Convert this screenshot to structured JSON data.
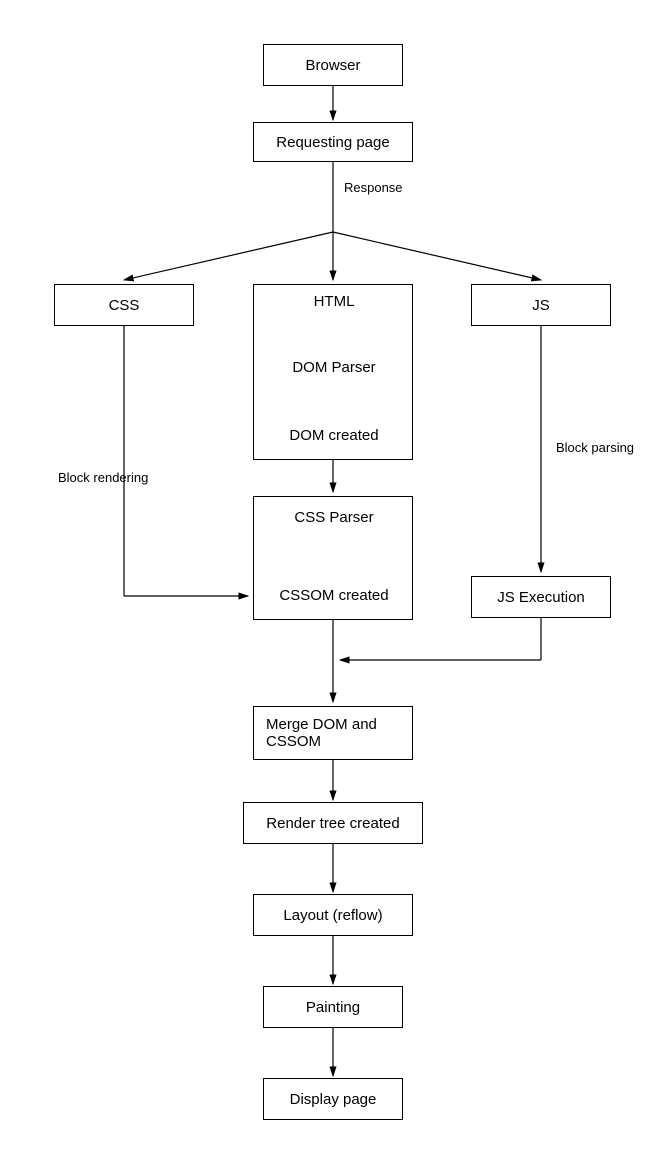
{
  "nodes": {
    "browser": "Browser",
    "requesting_page": "Requesting page",
    "css": "CSS",
    "html": "HTML",
    "dom_parser": "DOM Parser",
    "dom_created": "DOM created",
    "js": "JS",
    "css_parser": "CSS Parser",
    "cssom_created": "CSSOM created",
    "js_execution": "JS Execution",
    "merge": "Merge DOM and CSSOM",
    "render_tree": "Render tree created",
    "layout": "Layout (reflow)",
    "painting": "Painting",
    "display_page": "Display page"
  },
  "edges": {
    "response": "Response",
    "block_rendering": "Block rendering",
    "block_parsing": "Block parsing"
  }
}
